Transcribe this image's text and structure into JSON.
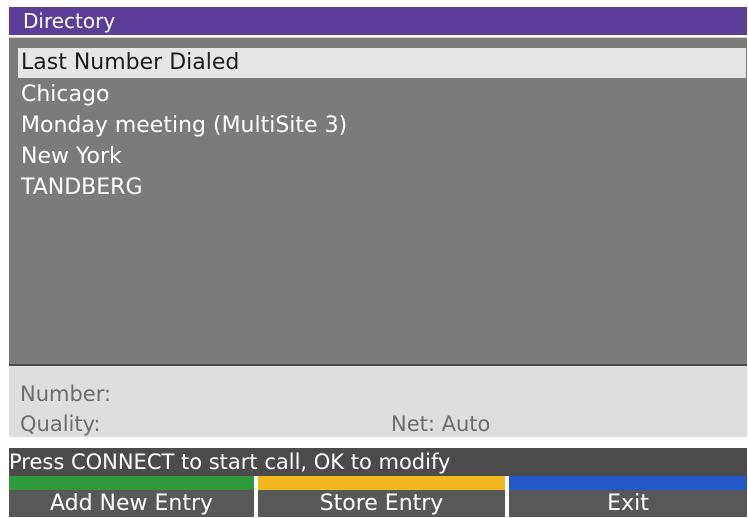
{
  "window": {
    "title": "Directory"
  },
  "directory": {
    "entries": [
      {
        "label": "Last Number Dialed",
        "selected": true
      },
      {
        "label": "Chicago",
        "selected": false
      },
      {
        "label": "Monday meeting (MultiSite 3)",
        "selected": false
      },
      {
        "label": "New York",
        "selected": false
      },
      {
        "label": "TANDBERG",
        "selected": false
      }
    ]
  },
  "details": {
    "number_label": "Number:",
    "quality_label": "Quality:",
    "net_label": "Net: Auto"
  },
  "status": {
    "message": "Press CONNECT to start call, OK to modify"
  },
  "softkeys": [
    {
      "label": "Add New Entry",
      "color": "#2e9a3a"
    },
    {
      "label": "Store Entry",
      "color": "#f2b81e"
    },
    {
      "label": "Exit",
      "color": "#2457c9"
    }
  ],
  "colors": {
    "title_bar": "#5a3e97",
    "list_background": "#7b7b7b",
    "selection": "#e6e6e6",
    "info_background": "#dedede",
    "status_background": "#4b4b4b",
    "softkey_background": "#585858"
  }
}
